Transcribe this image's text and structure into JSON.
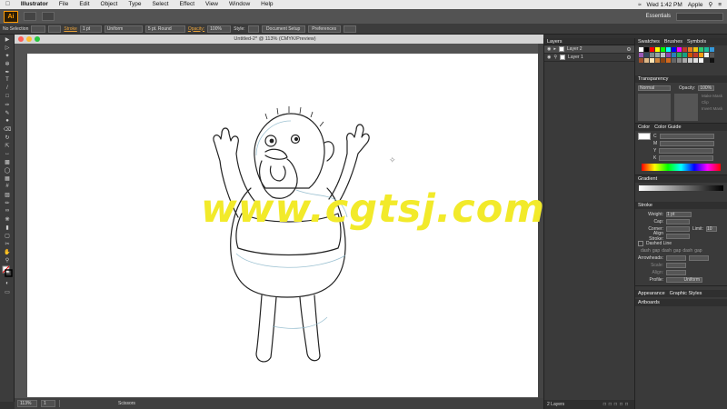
{
  "menubar": {
    "app": "Illustrator",
    "items": [
      "File",
      "Edit",
      "Object",
      "Type",
      "Select",
      "Effect",
      "View",
      "Window",
      "Help"
    ],
    "clock": "Wed 1:42 PM",
    "user": "Apple"
  },
  "app_bar": {
    "logo": "Ai",
    "workspace": "Essentials"
  },
  "control_bar": {
    "selection": "No Selection",
    "stroke_label": "Stroke",
    "stroke_weight": "1 pt",
    "profile": "Uniform",
    "brush": "5 pt. Round",
    "opacity_label": "Opacity:",
    "opacity_value": "100%",
    "style_label": "Style:",
    "document_setup": "Document Setup",
    "preferences": "Preferences"
  },
  "document": {
    "title": "Untitled-2* @ 113% (CMYK/Preview)"
  },
  "status_bar": {
    "zoom": "113%",
    "page": "1",
    "tool": "Scissors"
  },
  "layers_panel": {
    "tab": "Layers",
    "layers": [
      {
        "name": "Layer 2",
        "selected": true
      },
      {
        "name": "Layer 1",
        "selected": false
      }
    ],
    "footer": "2 Layers"
  },
  "right_dock": {
    "swatches_tabs": [
      "Swatches",
      "Brushes",
      "Symbols"
    ],
    "swatch_colors": [
      "#ffffff",
      "#000000",
      "#ff0000",
      "#ffff00",
      "#00ff00",
      "#00ffff",
      "#0000ff",
      "#ff00ff",
      "#c0392b",
      "#e67e22",
      "#f1c40f",
      "#2ecc71",
      "#1abc9c",
      "#3498db",
      "#9b59b6",
      "#34495e",
      "#7f8c8d",
      "#95a5a6",
      "#bdc3c7",
      "#8e44ad",
      "#2980b9",
      "#27ae60",
      "#16a085",
      "#d35400",
      "#c0392b",
      "#f39c12",
      "#ecf0f1",
      "#555555",
      "#a0522d",
      "#deb887",
      "#ffe4b5",
      "#cd853f",
      "#8b4513",
      "#d2691e",
      "#666666",
      "#888888",
      "#aaaaaa",
      "#cccccc",
      "#e0e0e0",
      "#f5f5f5",
      "#333333",
      "#111111"
    ],
    "transparency": {
      "title": "Transparency",
      "mode": "Normal",
      "opacity_label": "Opacity:",
      "opacity": "100%",
      "make_mask": "Make Mask",
      "clip": "Clip",
      "invert_mask": "Invert Mask"
    },
    "color": {
      "tabs": [
        "Color",
        "Color Guide"
      ],
      "channels": [
        "C",
        "M",
        "Y",
        "K"
      ]
    },
    "gradient": {
      "title": "Gradient"
    },
    "stroke": {
      "title": "Stroke",
      "weight_label": "Weight:",
      "weight": "1 pt",
      "cap_label": "Cap:",
      "corner_label": "Corner:",
      "limit_label": "Limit:",
      "limit": "10",
      "align_label": "Align Stroke:",
      "dashed_label": "Dashed Line",
      "dash_labels": [
        "dash",
        "gap",
        "dash",
        "gap",
        "dash",
        "gap"
      ],
      "arrowheads_label": "Arrowheads:",
      "scale_label": "Scale:",
      "align2_label": "Align:",
      "profile_label": "Profile:",
      "profile": "Uniform"
    },
    "appearance_tabs": [
      "Appearance",
      "Graphic Styles"
    ],
    "artboards": "Artboards"
  },
  "watermark": "www.cgtsj.com"
}
